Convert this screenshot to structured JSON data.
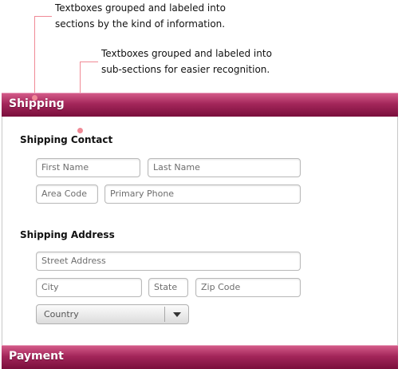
{
  "annotations": {
    "sections_note": [
      "Textboxes grouped and labeled into",
      "sections by the kind of information."
    ],
    "subsections_note": [
      "Textboxes grouped and labeled into",
      "sub-sections for easier recognition."
    ]
  },
  "colors": {
    "section_bar": "#9b1f50",
    "leader_line": "#f08a96"
  },
  "shipping": {
    "title": "Shipping",
    "contact": {
      "heading": "Shipping Contact",
      "first_name": "First Name",
      "last_name": "Last Name",
      "area_code": "Area Code",
      "primary_phone": "Primary Phone"
    },
    "address": {
      "heading": "Shipping Address",
      "street": "Street Address",
      "city": "City",
      "state": "State",
      "zip": "Zip Code",
      "country": "Country",
      "country_icon": "chevron-down-icon"
    }
  },
  "payment": {
    "title": "Payment"
  }
}
